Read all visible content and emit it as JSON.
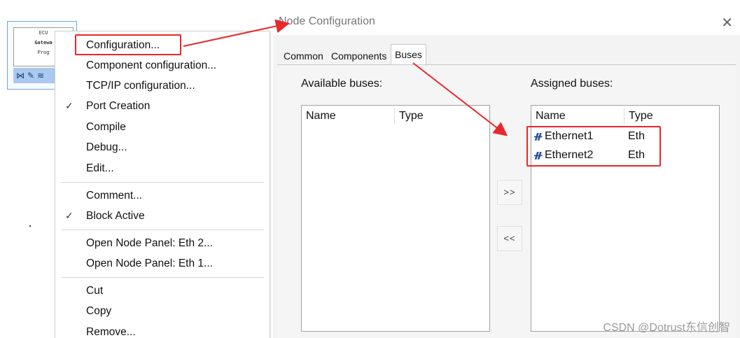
{
  "ecu_block": {
    "line1": "ECU",
    "line2": "Gatewa",
    "line3": "Prog",
    "toolbar_icons": [
      "network-icon",
      "pencil-icon",
      "layers-icon"
    ]
  },
  "context_menu": {
    "items": [
      {
        "label": "Configuration...",
        "checked": false
      },
      {
        "label": "Component configuration...",
        "checked": false
      },
      {
        "label": "TCP/IP configuration...",
        "checked": false
      },
      {
        "label": "Port Creation",
        "checked": true
      },
      {
        "label": "Compile",
        "checked": false
      },
      {
        "label": "Debug...",
        "checked": false
      },
      {
        "label": "Edit...",
        "checked": false
      },
      {
        "label": "Comment...",
        "checked": false
      },
      {
        "label": "Block Active",
        "checked": true
      },
      {
        "label": "Open Node Panel: Eth 2...",
        "checked": false
      },
      {
        "label": "Open Node Panel: Eth 1...",
        "checked": false
      },
      {
        "label": "Cut",
        "checked": false
      },
      {
        "label": "Copy",
        "checked": false
      },
      {
        "label": "Remove...",
        "checked": false
      }
    ],
    "check_glyph": "✓"
  },
  "dialog": {
    "title": "Node Configuration",
    "close_glyph": "✕",
    "tabs": [
      "Common",
      "Components",
      "Buses"
    ],
    "active_tab": "Buses",
    "available": {
      "label": "Available buses:",
      "columns": [
        "Name",
        "Type"
      ],
      "rows": []
    },
    "assigned": {
      "label": "Assigned buses:",
      "columns": [
        "Name",
        "Type"
      ],
      "rows": [
        {
          "name": "Ethernet1",
          "type": "Eth"
        },
        {
          "name": "Ethernet2",
          "type": "Eth"
        }
      ]
    },
    "add_button": ">>",
    "remove_button": "<<"
  },
  "annotation_color": "#e8282b",
  "watermark": "CSDN @Dotrust东信创智"
}
